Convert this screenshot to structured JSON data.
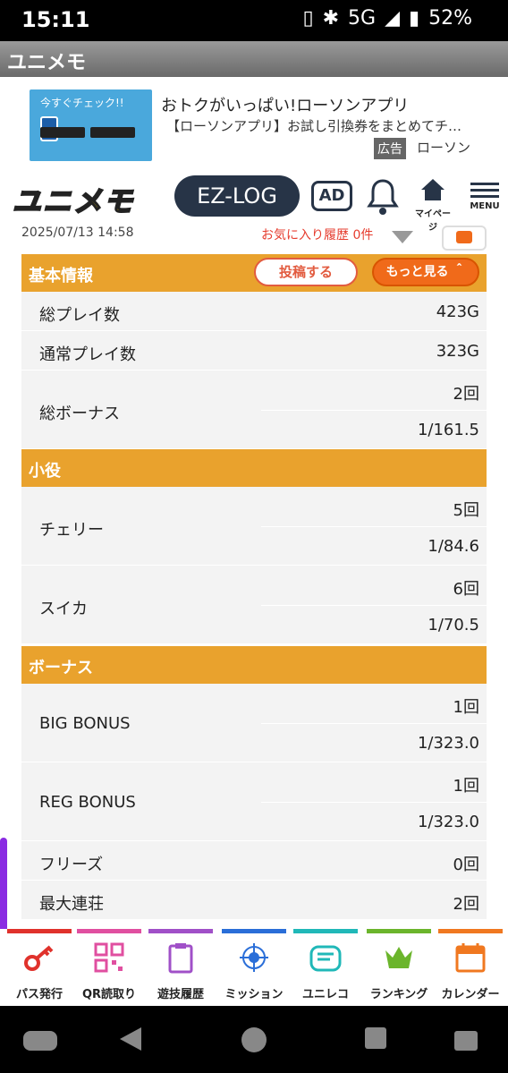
{
  "status": {
    "time": "15:11",
    "network": "5G",
    "battery": "52%"
  },
  "app_title": "ユニメモ",
  "ad": {
    "image_text": "今すぐチェック!!",
    "title": "おトクがいっぱい!ローソンアプリ",
    "desc": "【ローソンアプリ】お試し引換券をまとめてチ…",
    "tag": "広告",
    "advertiser": "ローソン"
  },
  "header": {
    "logo": "ユニメモ",
    "ezlog": "EZ-LOG",
    "ad_btn": "AD",
    "mypage": "マイページ",
    "menu": "MENU"
  },
  "meta": {
    "date": "2025/07/13 14:58",
    "fav": "お気に入り履歴 0件"
  },
  "sections": {
    "basic": {
      "title": "基本情報",
      "post_btn": "投稿する",
      "more_btn": "もっと見る ＾"
    },
    "koyaku": {
      "title": "小役"
    },
    "bonus": {
      "title": "ボーナス"
    }
  },
  "rows": {
    "total_play": {
      "k": "総プレイ数",
      "v": "423G"
    },
    "normal_play": {
      "k": "通常プレイ数",
      "v": "323G"
    },
    "total_bonus": {
      "k": "総ボーナス",
      "v1": "2回",
      "v2": "1/161.5"
    },
    "cherry": {
      "k": "チェリー",
      "v1": "5回",
      "v2": "1/84.6"
    },
    "suika": {
      "k": "スイカ",
      "v1": "6回",
      "v2": "1/70.5"
    },
    "big": {
      "k": "BIG BONUS",
      "v1": "1回",
      "v2": "1/323.0"
    },
    "reg": {
      "k": "REG BONUS",
      "v1": "1回",
      "v2": "1/323.0"
    },
    "freeze": {
      "k": "フリーズ",
      "v": "0回"
    },
    "max_chain": {
      "k": "最大連荘",
      "v": "2回"
    }
  },
  "nav": [
    {
      "label": "パス発行",
      "color": "#e0322c"
    },
    {
      "label": "QR読取り",
      "color": "#e04fa0"
    },
    {
      "label": "遊技履歴",
      "color": "#a050c8"
    },
    {
      "label": "ミッション",
      "color": "#2a6ed8"
    },
    {
      "label": "ユニレコ",
      "color": "#20b8b8"
    },
    {
      "label": "ランキング",
      "color": "#6bb52c"
    },
    {
      "label": "カレンダー",
      "color": "#f07820"
    }
  ]
}
